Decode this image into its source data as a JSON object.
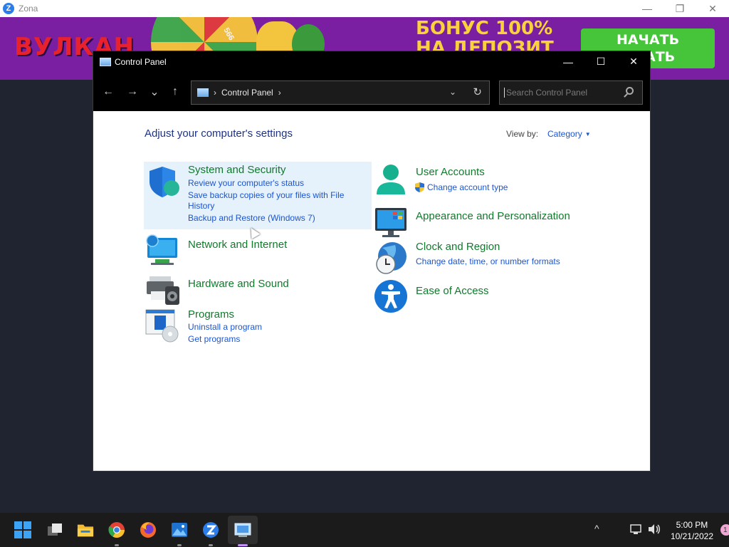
{
  "zona": {
    "title": "Zona",
    "banner_logo": "ВУЛКАН",
    "banner_bonus_line1": "БОНУС 100%",
    "banner_bonus_line2": "НА ДЕПОЗИТ",
    "banner_button_line1": "НАЧАТЬ",
    "banner_button_line2": "ЫВАТЬ",
    "wheel_number_1": "566",
    "wheel_number_2": "00"
  },
  "window": {
    "title": "Control Panel",
    "minimize": "—",
    "maximize": "☐",
    "close": "✕"
  },
  "navbar": {
    "back": "←",
    "forward": "→",
    "recent": "⌄",
    "up": "↑",
    "address_separator": "›",
    "address_crumb": "Control Panel",
    "address_trailing": "›",
    "address_dropdown": "⌄",
    "refresh": "↻",
    "search_placeholder": "Search Control Panel"
  },
  "content": {
    "heading": "Adjust your computer's settings",
    "view_by_label": "View by:",
    "view_by_value": "Category",
    "left": [
      {
        "title": "System and Security",
        "links": [
          "Review your computer's status",
          "Save backup copies of your files with File",
          "History",
          "Backup and Restore (Windows 7)"
        ]
      },
      {
        "title": "Network and Internet",
        "links": []
      },
      {
        "title": "Hardware and Sound",
        "links": []
      },
      {
        "title": "Programs",
        "links": [
          "Uninstall a program",
          "Get programs"
        ]
      }
    ],
    "right": [
      {
        "title": "User Accounts",
        "links": [
          "Change account type"
        ]
      },
      {
        "title": "Appearance and Personalization",
        "links": []
      },
      {
        "title": "Clock and Region",
        "links": [
          "Change date, time, or number formats"
        ]
      },
      {
        "title": "Ease of Access",
        "links": []
      }
    ]
  },
  "taskbar": {
    "time": "5:00 PM",
    "date": "10/21/2022",
    "tray_chevron": "^",
    "notification_count": "1"
  },
  "colors": {
    "title_green": "#117a2c",
    "link_blue": "#1b55d2",
    "heading_blue": "#1e3287",
    "hover_bg": "#e5f1fb"
  }
}
